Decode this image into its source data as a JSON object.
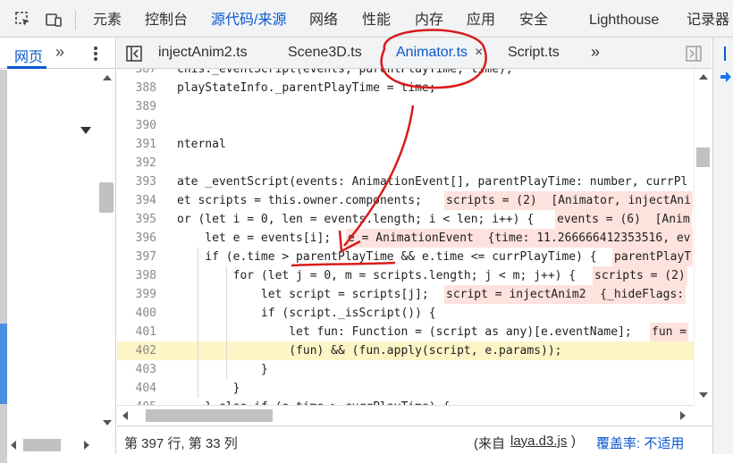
{
  "top_tabs": [
    "元素",
    "控制台",
    "源代码/来源",
    "网络",
    "性能",
    "内存",
    "应用",
    "安全",
    "Lighthouse",
    "记录器"
  ],
  "left": {
    "tab": "网页",
    "more": "»"
  },
  "file_tabs": [
    "injectAnim2.ts",
    "Scene3D.ts",
    "Animator.ts",
    "Script.ts"
  ],
  "file_close": "×",
  "file_more": "»",
  "lines": [
    {
      "n": "387",
      "t": "chis._eventScript(events, parentPlayTime, time);"
    },
    {
      "n": "388",
      "t": "playStateInfo._parentPlayTime = time;"
    },
    {
      "n": "389",
      "t": ""
    },
    {
      "n": "390",
      "t": ""
    },
    {
      "n": "391",
      "t": "nternal"
    },
    {
      "n": "392",
      "t": ""
    },
    {
      "n": "393",
      "t": "ate _eventScript(events: AnimationEvent[], parentPlayTime: number, currPl"
    },
    {
      "n": "394",
      "t": "et scripts = this.owner.components;",
      "v": "scripts = (2)  [Animator, injectAni"
    },
    {
      "n": "395",
      "t": "or (let i = 0, len = events.length; i < len; i++) {",
      "v": "events = (6)  [Anim"
    },
    {
      "n": "396",
      "t": "    let e = events[i];",
      "v": "e = AnimationEvent  {time: 11.266666412353516, ev"
    },
    {
      "n": "397",
      "t": "    if (e.time > parentPlayTime && e.time <= currPlayTime) {",
      "v": "parentPlayT"
    },
    {
      "n": "398",
      "t": "        for (let j = 0, m = scripts.length; j < m; j++) {",
      "v": "scripts = (2)"
    },
    {
      "n": "399",
      "t": "            let script = scripts[j];",
      "v": "script = injectAnim2  {_hideFlags:"
    },
    {
      "n": "400",
      "t": "            if (script._isScript()) {"
    },
    {
      "n": "401",
      "t": "                let fun: Function = (script as any)[e.eventName];",
      "v": "fun ="
    },
    {
      "n": "402",
      "t": "                (fun) && (fun.apply(script, e.params));"
    },
    {
      "n": "403",
      "t": "            }"
    },
    {
      "n": "404",
      "t": "        }"
    },
    {
      "n": "405",
      "t": "    } else if (e.time > currPlayTime) {"
    }
  ],
  "status": {
    "position": "第 397 行, 第 33 列",
    "source_prefix": "(来自",
    "source_file": "laya.d3.js",
    "source_suffix": ")",
    "coverage": "覆盖率: 不适用"
  },
  "colors": {
    "accent": "#0b57d0",
    "annotation": "#d81b1b",
    "highlight": "#fdf5c6"
  }
}
